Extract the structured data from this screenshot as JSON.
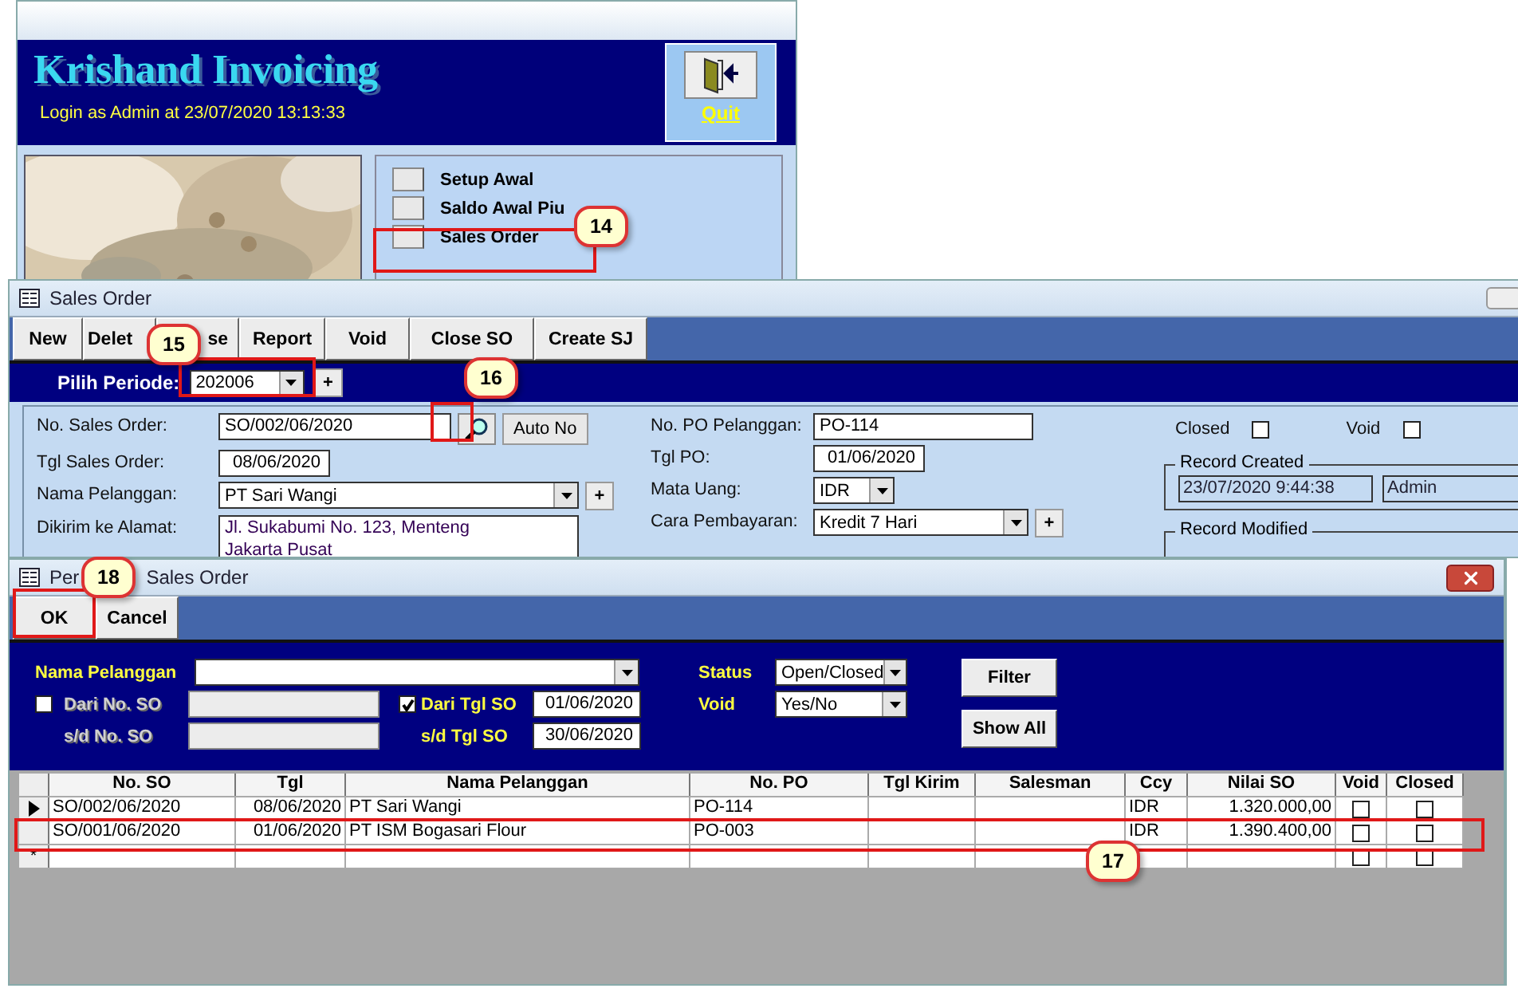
{
  "main_window": {
    "title": "Krishand Invoicing",
    "login": "Login as Admin at 23/07/2020 13:13:33",
    "quit_label": "Quit",
    "menu": [
      {
        "label": "Setup Awal"
      },
      {
        "label": "Saldo Awal Piu"
      },
      {
        "label": "Sales Order"
      }
    ]
  },
  "sales_order_window": {
    "title": "Sales Order",
    "toolbar": [
      "New",
      "Delet",
      "se",
      "Report",
      "Void",
      "Close SO",
      "Create SJ"
    ],
    "period_label": "Pilih Periode:",
    "period": "202006",
    "period_add": "+",
    "left_fields": [
      {
        "kind": "search",
        "label": "No. Sales Order:",
        "value": "SO/002/06/2020",
        "button": "Auto No"
      },
      {
        "kind": "date",
        "label": "Tgl Sales Order:",
        "value": "08/06/2020"
      },
      {
        "kind": "combo_plus",
        "label": "Nama Pelanggan:",
        "value": "PT Sari Wangi",
        "add": "+"
      },
      {
        "kind": "memo",
        "label": "Dikirim ke Alamat:",
        "lines": [
          "Jl. Sukabumi No. 123, Menteng",
          "Jakarta Pusat"
        ]
      }
    ],
    "middle_fields": [
      {
        "kind": "text",
        "label": "No. PO Pelanggan:",
        "value": "PO-114"
      },
      {
        "kind": "date",
        "label": "Tgl PO:",
        "value": "01/06/2020"
      },
      {
        "kind": "small_combo",
        "label": "Mata Uang:",
        "value": "IDR"
      },
      {
        "kind": "combo_plus",
        "label": "Cara Pembayaran:",
        "value": "Kredit 7 Hari",
        "add": "+"
      }
    ],
    "flags": [
      {
        "label": "Closed",
        "checked": false
      },
      {
        "label": "Void",
        "checked": false
      }
    ],
    "record_created": {
      "legend": "Record Created",
      "date": "23/07/2020 9:44:38",
      "user": "Admin"
    },
    "record_modified": {
      "legend": "Record Modified"
    }
  },
  "dialog": {
    "title_start": "Per",
    "title_end": "Sales Order",
    "buttons": [
      "OK",
      "Cancel"
    ],
    "customer_label": "Nama Pelanggan",
    "range_rows": [
      {
        "label": "Dari No. SO",
        "checked": false,
        "date_label": "Dari Tgl SO",
        "date_checked": true,
        "date": "01/06/2020"
      },
      {
        "label": "s/d No. SO",
        "date_label": "s/d Tgl SO",
        "date": "30/06/2020"
      }
    ],
    "status": [
      {
        "label": "Status",
        "value": "Open/Closed"
      },
      {
        "label": "Void",
        "value": "Yes/No"
      }
    ],
    "actions": [
      "Filter",
      "Show All"
    ],
    "table": {
      "columns": [
        "No. SO",
        "Tgl",
        "Nama Pelanggan",
        "No. PO",
        "Tgl Kirim",
        "Salesman",
        "Ccy",
        "Nilai SO",
        "Void",
        "Closed"
      ],
      "rows": [
        {
          "kind": "record",
          "selected": true,
          "cells": [
            "SO/002/06/2020",
            "08/06/2020",
            "PT Sari Wangi",
            "PO-114",
            "",
            "",
            "IDR",
            "1.320.000,00"
          ],
          "void": false,
          "closed": false
        },
        {
          "kind": "record",
          "selected": false,
          "cells": [
            "SO/001/06/2020",
            "01/06/2020",
            "PT ISM Bogasari Flour",
            "PO-003",
            "",
            "",
            "IDR",
            "1.390.400,00"
          ],
          "void": false,
          "closed": false
        },
        {
          "kind": "new",
          "marker": "*",
          "void": false,
          "closed": false
        }
      ]
    }
  },
  "callouts": [
    "14",
    "15",
    "16",
    "17",
    "18"
  ]
}
